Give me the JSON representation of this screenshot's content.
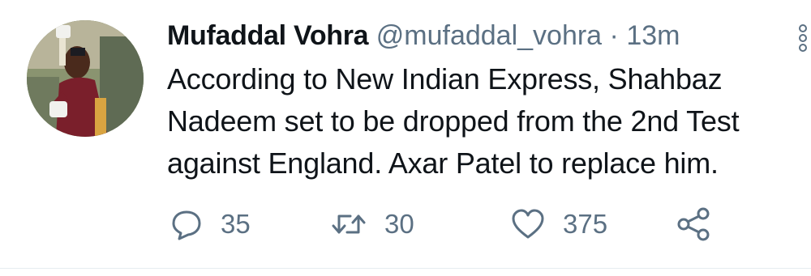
{
  "tweet": {
    "author": {
      "name": "Mufaddal Vohra",
      "handle": "@mufaddal_vohra",
      "separator": "·",
      "time": "13m"
    },
    "text_lines": [
      "According to New Indian Express, Shahbaz",
      "Nadeem set to be dropped from the 2nd Test",
      "against England. Axar Patel to replace him."
    ],
    "actions": {
      "reply": {
        "icon": "reply-icon",
        "count": "35"
      },
      "retweet": {
        "icon": "retweet-icon",
        "count": "30"
      },
      "like": {
        "icon": "heart-icon",
        "count": "375"
      },
      "share": {
        "icon": "share-icon"
      }
    }
  },
  "colors": {
    "text": "#0f1419",
    "secondary": "#5b7083",
    "divider": "#e6ecf0"
  }
}
